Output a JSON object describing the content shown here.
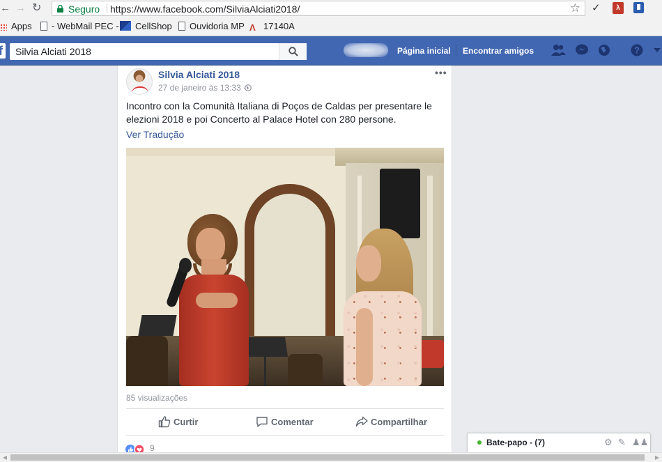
{
  "browser": {
    "secure_label": "Seguro",
    "url": "https://www.facebook.com/SilviaAlciati2018/",
    "bookmarks": [
      {
        "label": "Apps",
        "icon": "apps-grid-icon"
      },
      {
        "label": "- WebMail PEC -",
        "icon": "page-icon"
      },
      {
        "label": "CellShop",
        "icon": "cellshop-icon"
      },
      {
        "label": "Ouvidoria MP",
        "icon": "page-icon"
      },
      {
        "label": "17140A",
        "icon": "a-logo-icon"
      }
    ]
  },
  "header": {
    "search_value": "Silvia Alciati 2018",
    "nav_home": "Página inicial",
    "nav_find_friends": "Encontrar amigos",
    "brand_color": "#4267b2"
  },
  "post": {
    "author": "Silvia Alciati 2018",
    "timestamp": "27 de janeiro às 13:33 ·",
    "text": "Incontro con la Comunità Italiana di Poços de Caldas per presentare le elezioni 2018 e poi Concerto al Palace Hotel con 280 persone.",
    "see_translation": "Ver Tradução",
    "views": "85 visualizações",
    "actions": {
      "like": "Curtir",
      "comment": "Comentar",
      "share": "Compartilhar"
    },
    "reaction_count": "9"
  },
  "chat": {
    "label": "Bate-papo - (7)",
    "status_color": "#42b72a"
  }
}
